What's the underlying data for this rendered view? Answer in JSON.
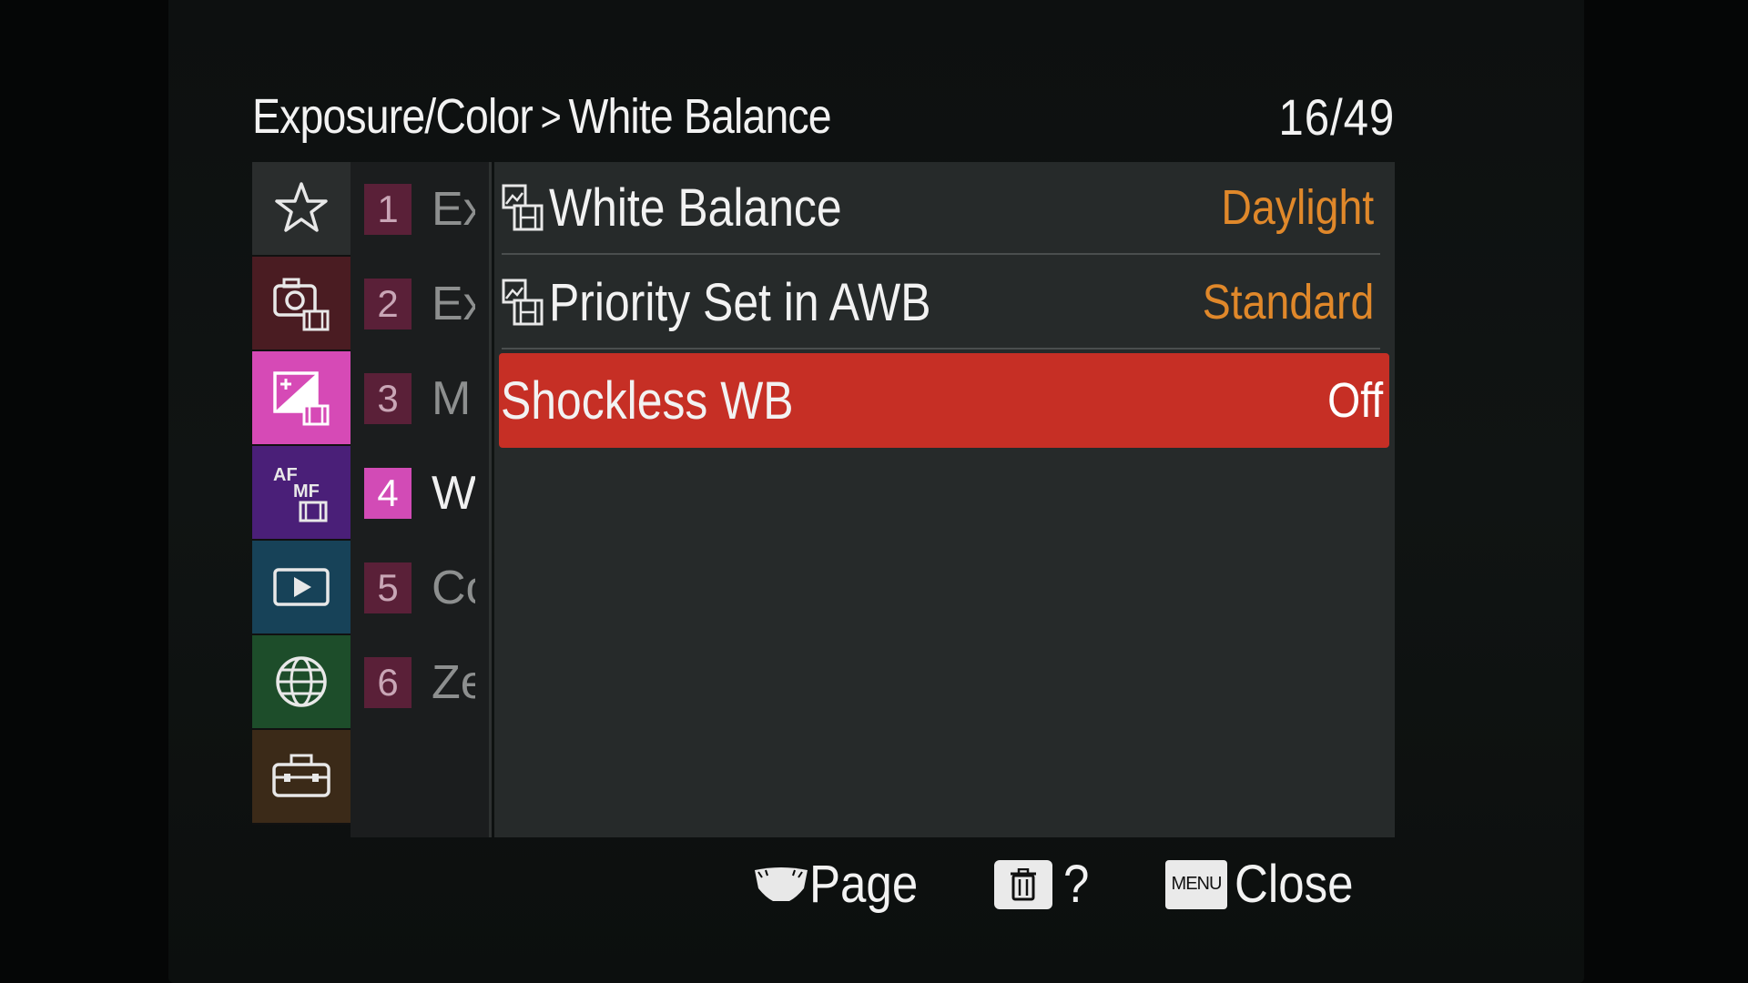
{
  "header": {
    "breadcrumb_parent": "Exposure/Color",
    "breadcrumb_separator": ">",
    "breadcrumb_current": "White Balance",
    "page_counter": "16/49"
  },
  "sidebar": {
    "items": [
      {
        "icon": "star-icon",
        "color": "#2a2d2d"
      },
      {
        "icon": "camera-movie-icon",
        "color": "#4a1c22"
      },
      {
        "icon": "exposure-movie-icon",
        "color": "#d64ab6",
        "selected": true
      },
      {
        "icon": "af-mf-movie-icon",
        "color": "#4a1f78"
      },
      {
        "icon": "play-icon",
        "color": "#174258"
      },
      {
        "icon": "globe-icon",
        "color": "#1d4d2a"
      },
      {
        "icon": "toolbox-icon",
        "color": "#3b2a18"
      }
    ]
  },
  "submenu": {
    "items": [
      {
        "num": "1",
        "label": "Ex"
      },
      {
        "num": "2",
        "label": "Ex"
      },
      {
        "num": "3",
        "label": "M"
      },
      {
        "num": "4",
        "label": "W",
        "active": true
      },
      {
        "num": "5",
        "label": "Co"
      },
      {
        "num": "6",
        "label": "Ze"
      }
    ]
  },
  "settings": {
    "rows": [
      {
        "label": "White Balance",
        "value": "Daylight",
        "icon": "still-movie-icon"
      },
      {
        "label": "Priority Set in AWB",
        "value": "Standard",
        "icon": "still-movie-icon"
      },
      {
        "label": "Shockless WB",
        "value": "Off",
        "selected": true
      }
    ]
  },
  "footer": {
    "page_label": "Page",
    "help_label": "?",
    "menu_badge": "MENU",
    "close_label": "Close"
  },
  "colors": {
    "selection_red": "#c62f25",
    "value_orange": "#e0882a",
    "active_magenta": "#d64ab6"
  }
}
